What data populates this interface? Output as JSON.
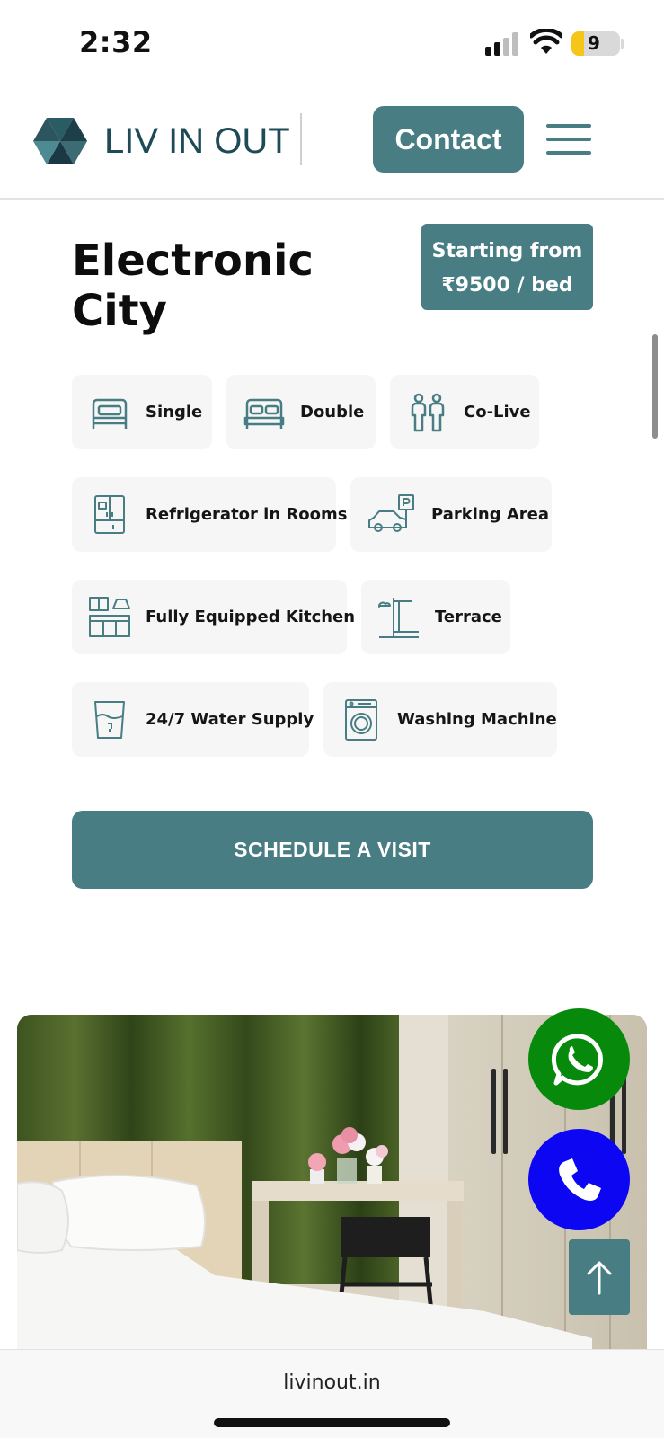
{
  "status_bar": {
    "time": "2:32",
    "battery_level": "9"
  },
  "header": {
    "logo_text": "LIV IN OUT",
    "contact_label": "Contact",
    "brand_color": "#477d83"
  },
  "property": {
    "title": "Electronic City",
    "price_line1": "Starting from",
    "price_line2": "₹9500 / bed"
  },
  "room_types": [
    {
      "label": "Single",
      "icon": "single-bed-icon"
    },
    {
      "label": "Double",
      "icon": "double-bed-icon"
    },
    {
      "label": "Co-Live",
      "icon": "people-icon"
    }
  ],
  "amenities": [
    {
      "label": "Refrigerator in Rooms",
      "icon": "refrigerator-icon"
    },
    {
      "label": "Parking Area",
      "icon": "parking-car-icon"
    },
    {
      "label": "Fully Equipped Kitchen",
      "icon": "kitchen-icon"
    },
    {
      "label": "Terrace",
      "icon": "terrace-icon"
    },
    {
      "label": "24/7 Water Supply",
      "icon": "water-supply-icon"
    },
    {
      "label": "Washing Machine",
      "icon": "washing-machine-icon"
    }
  ],
  "schedule_label": "SCHEDULE A VISIT",
  "floating": {
    "whatsapp_color": "#078a0c",
    "call_color": "#0d06f2"
  },
  "browser": {
    "url": "livinout.in"
  }
}
